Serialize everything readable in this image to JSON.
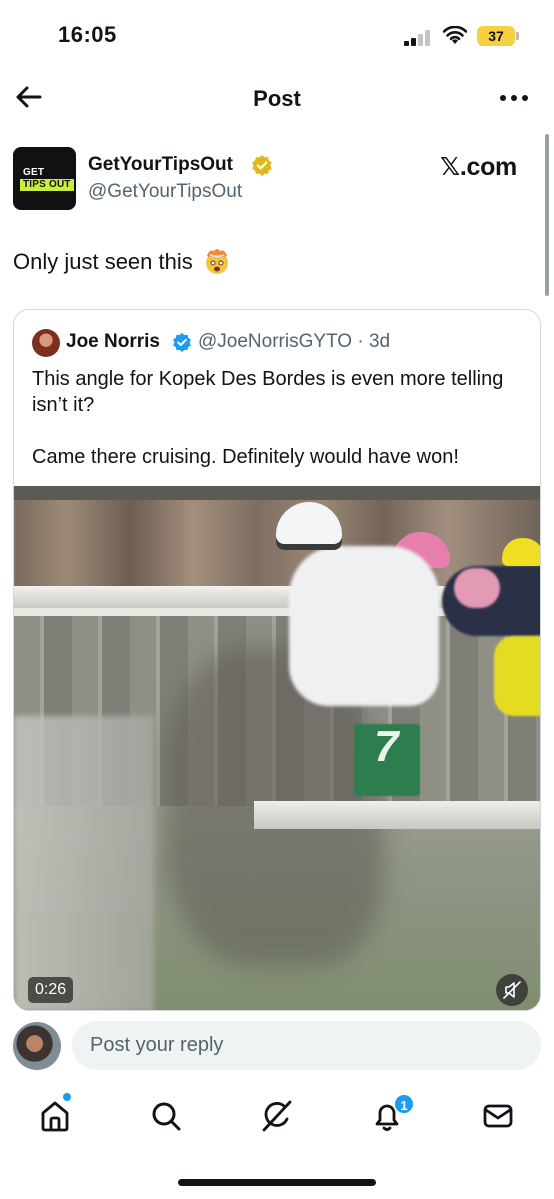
{
  "status_bar": {
    "time": "16:05",
    "battery": "37",
    "icons": [
      "signal-icon",
      "wifi-icon",
      "battery-icon"
    ],
    "battery_color": "#f5d142"
  },
  "header": {
    "title": "Post",
    "back_icon": "arrow-left-icon",
    "more_icon": "more-horizontal-icon"
  },
  "post": {
    "author": {
      "avatar_text_line1": "GET YOUR",
      "avatar_text_line2": "TIPS OUT",
      "name": "GetYourTipsOut",
      "handle": "@GetYourTipsOut",
      "verified": "gold"
    },
    "source": "𝕏.com",
    "text": "Only just seen this",
    "emoji": "exploding-head-emoji"
  },
  "quote": {
    "author_name": "Joe Norris",
    "handle_time": "@JoeNorrisGYTO · 3d",
    "verified": "blue",
    "text": "This angle for Kopek Des Bordes is even more telling isn’t it?\n\nCame there cruising. Definitely would have won!",
    "video": {
      "duration": "0:26",
      "saddle_number": "7",
      "muted": true
    }
  },
  "reply": {
    "placeholder": "Post your reply"
  },
  "bottom_nav": {
    "items": [
      {
        "icon": "home-icon",
        "active": true
      },
      {
        "icon": "search-icon"
      },
      {
        "icon": "grok-icon"
      },
      {
        "icon": "notifications-icon",
        "badge": "1"
      },
      {
        "icon": "messages-icon"
      }
    ]
  },
  "colors": {
    "accent": "#1d9bf0",
    "text": "#0f1419",
    "secondary_text": "#536471",
    "gold_badge": "#e2b719",
    "brand_green": "#c7ee3b"
  }
}
